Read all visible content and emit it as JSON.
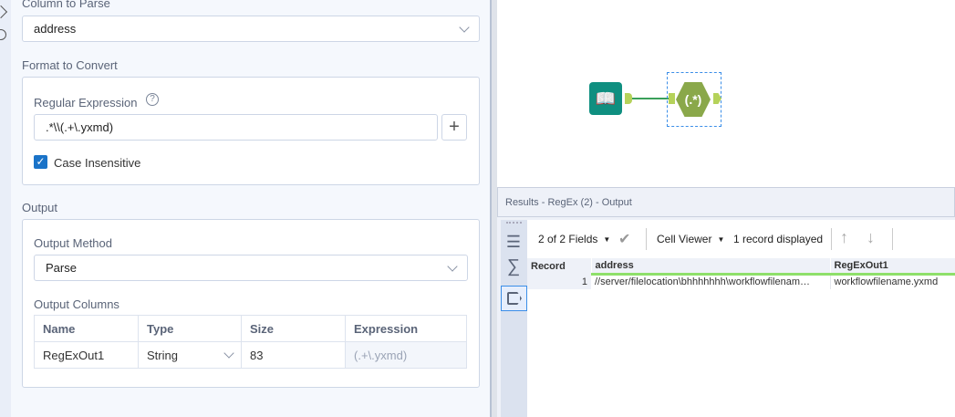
{
  "config": {
    "column_to_parse": {
      "label": "Column to Parse",
      "value": "address"
    },
    "format_to_convert": {
      "label": "Format to Convert",
      "regex_label": "Regular Expression",
      "regex_value": ".*\\\\(.+\\.yxmd)",
      "case_insensitive_label": "Case Insensitive",
      "case_insensitive_checked": true
    },
    "output": {
      "label": "Output",
      "method_label": "Output Method",
      "method_value": "Parse",
      "columns_label": "Output Columns",
      "headers": [
        "Name",
        "Type",
        "Size",
        "Expression"
      ],
      "rows": [
        {
          "name": "RegExOut1",
          "type": "String",
          "size": "83",
          "expression": "(.+\\.yxmd)"
        }
      ]
    }
  },
  "canvas": {
    "tools": [
      {
        "name": "Input Data"
      },
      {
        "name": "RegEx",
        "glyph": "(.*)"
      }
    ]
  },
  "results": {
    "title": "Results - RegEx (2) - Output",
    "fields": "2 of 2 Fields",
    "cell_viewer": "Cell Viewer",
    "records": "1 record displayed",
    "headers": [
      "Record",
      "address",
      "RegExOut1"
    ],
    "rows": [
      {
        "record": "1",
        "address": "//server/filelocation\\bhhhhhhh\\workflowfilenam…",
        "regexout1": "workflowfilename.yxmd"
      }
    ]
  },
  "colors": {
    "accent": "#1a73c8",
    "tool_green": "#8aa84a",
    "input_teal": "#0f8f80",
    "field_bar": "#8ee06a"
  }
}
